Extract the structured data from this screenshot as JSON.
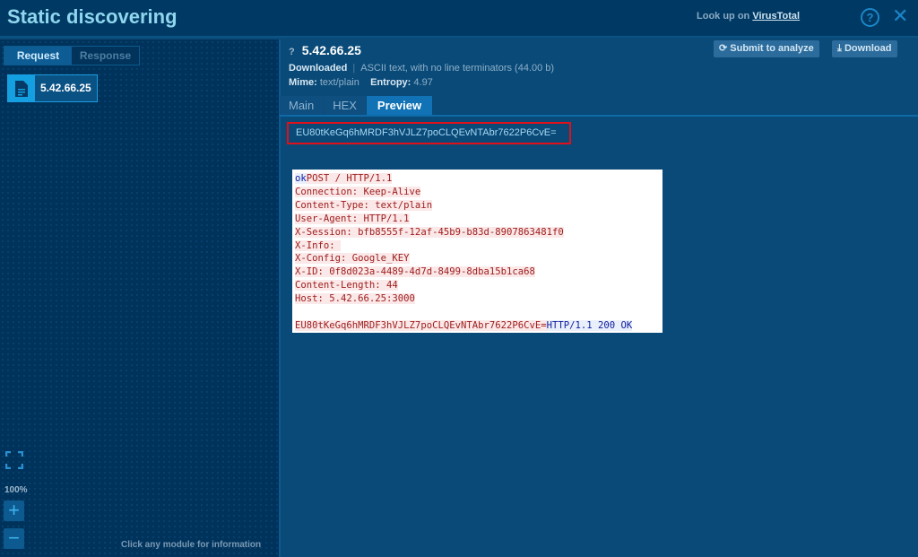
{
  "header": {
    "title": "Static discovering",
    "lookup_prefix": "Look up on",
    "lookup_link": "VirusTotal",
    "help": "?",
    "close": "✕"
  },
  "left": {
    "tabs": [
      "Request",
      "Response"
    ],
    "node_label": "5.42.66.25",
    "zoom": "100%",
    "zoom_in": "+",
    "zoom_out": "−",
    "hint": "Click any module for information"
  },
  "file": {
    "name": "5.42.66.25",
    "q": "?",
    "status": "Downloaded",
    "type": "ASCII text, with no line terminators (44.00 b)",
    "mime_label": "Mime:",
    "mime": "text/plain",
    "entropy_label": "Entropy:",
    "entropy": "4.97"
  },
  "actions": {
    "submit": "Submit to analyze",
    "download": "Download"
  },
  "tabs": [
    "Main",
    "HEX",
    "Preview"
  ],
  "raw": "EU80tKeGq6hMRDF3hVJLZ7poCLQEvNTAbr7622P6CvE=",
  "preview": {
    "first_prefix": "ok",
    "first": "POST / HTTP/1.1",
    "lines": [
      "Connection: Keep-Alive",
      "Content-Type: text/plain",
      "User-Agent: HTTP/1.1",
      "X-Session: bfb8555f-12af-45b9-b83d-8907863481f0",
      "X-Info: ",
      "X-Config: Google_KEY",
      "X-ID: 0f8d023a-4489-4d7d-8499-8dba15b1ca68",
      "Content-Length: 44",
      "Host: 5.42.66.25:3000"
    ],
    "body": "EU80tKeGq6hMRDF3hVJLZ7poCLQEvNTAbr7622P6CvE=",
    "response": "HTTP/1.1 200 OK"
  }
}
